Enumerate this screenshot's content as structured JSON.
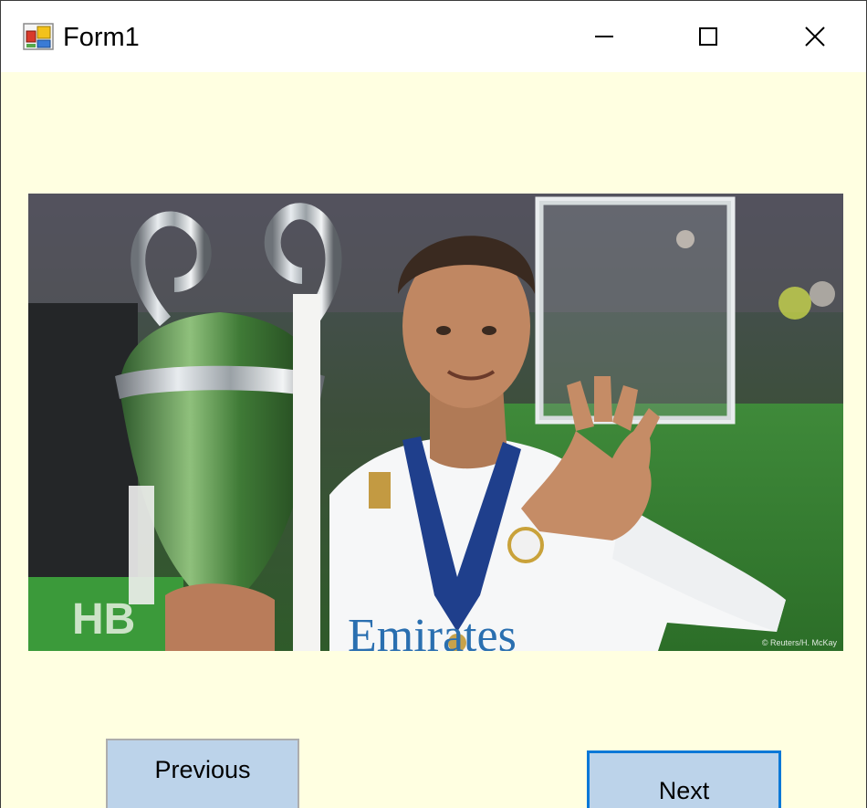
{
  "window": {
    "title": "Form1",
    "app_icon": "winforms-app-icon",
    "controls": {
      "minimize_icon": "minimize-icon",
      "maximize_icon": "maximize-icon",
      "close_icon": "close-icon"
    }
  },
  "form": {
    "background_color": "#ffffe1",
    "picture": {
      "description_icon": "photo-image",
      "credit": "© Reuters/H. McKay"
    },
    "buttons": {
      "previous_label": "Previous",
      "next_label": "Next"
    }
  }
}
